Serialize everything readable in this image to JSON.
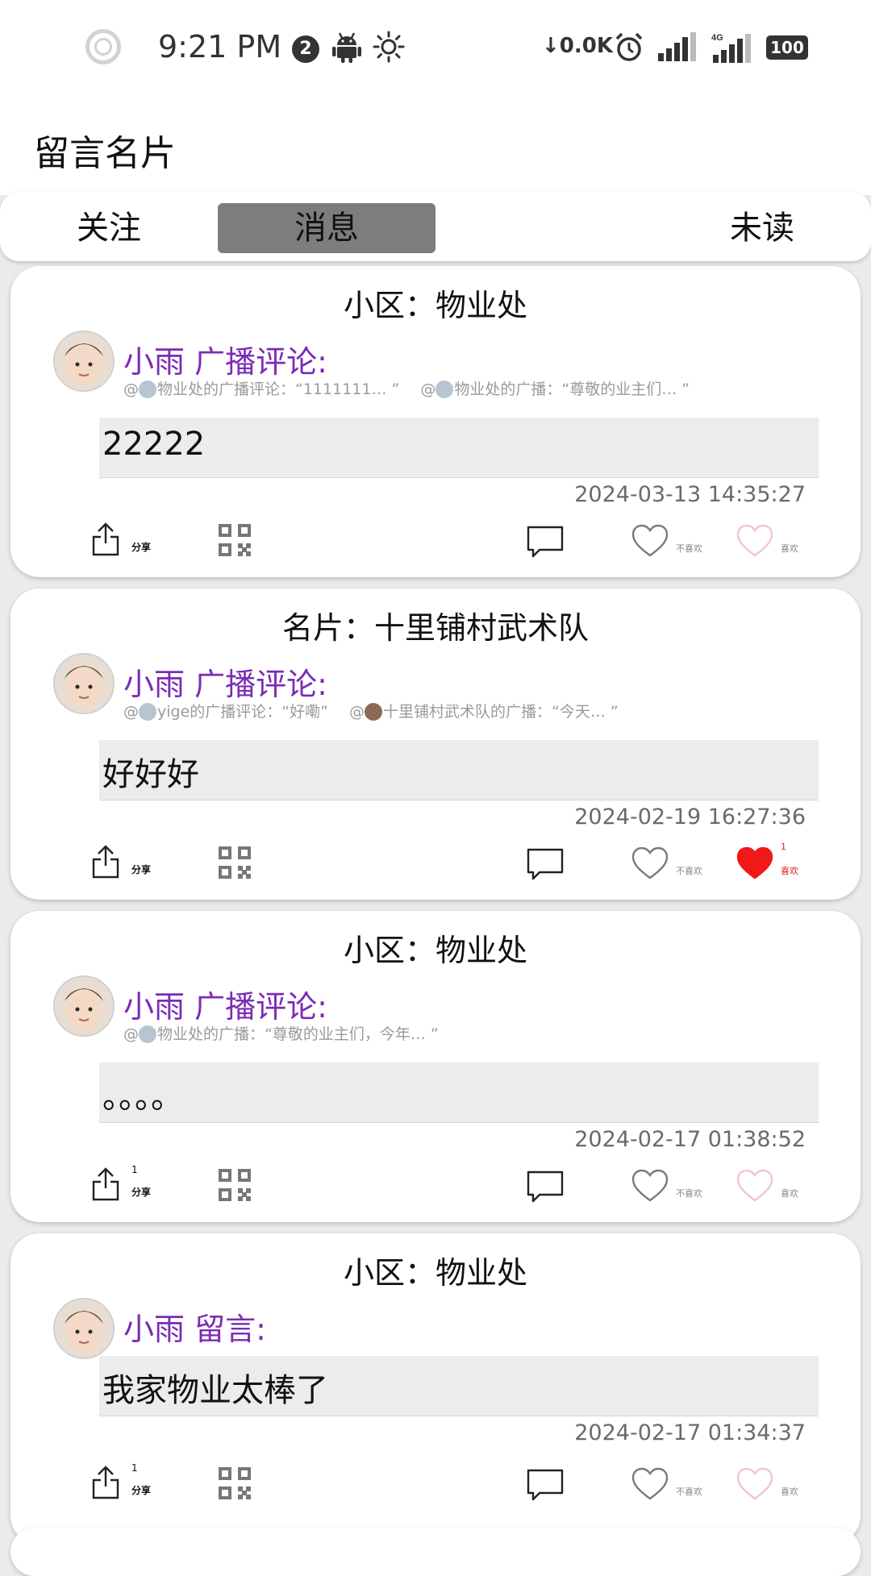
{
  "status_bar": {
    "time": "9:21 PM",
    "notification_count": "2",
    "net_speed": "0.0K",
    "network_label": "4G",
    "battery": "100"
  },
  "header": {
    "title": "留言名片"
  },
  "tabs": [
    {
      "label": "关注",
      "selected": false
    },
    {
      "label": "消息",
      "selected": true
    },
    {
      "label": "未读",
      "selected": false
    }
  ],
  "cards": [
    {
      "title": "小区：物业处",
      "author": "小雨 广播评论:",
      "quotes": [
        "物业处的广播评论：“1111111… ”",
        "物业处的广播：“尊敬的业主们… ”"
      ],
      "content": "22222",
      "time": "2024-03-13 14:35:27",
      "share_label": "分享",
      "share_count": "",
      "dislike_label": "不喜欢",
      "like_label": "喜欢",
      "like_count": "",
      "liked": false
    },
    {
      "title": "名片：十里铺村武术队",
      "author": "小雨 广播评论:",
      "quotes": [
        "yige的广播评论：“好嘞”",
        "十里铺村武术队的广播：“今天… ”"
      ],
      "content": "好好好",
      "time": "2024-02-19 16:27:36",
      "share_label": "分享",
      "share_count": "",
      "dislike_label": "不喜欢",
      "like_label": "喜欢",
      "like_count": "1",
      "liked": true
    },
    {
      "title": "小区：物业处",
      "author": "小雨 广播评论:",
      "quotes": [
        "物业处的广播：“尊敬的业主们，今年… ”"
      ],
      "content": "。。。。",
      "time": "2024-02-17 01:38:52",
      "share_label": "分享",
      "share_count": "1",
      "dislike_label": "不喜欢",
      "like_label": "喜欢",
      "like_count": "",
      "liked": false
    },
    {
      "title": "小区：物业处",
      "author": "小雨 留言:",
      "quotes": [],
      "content": "我家物业太棒了",
      "time": "2024-02-17 01:34:37",
      "share_label": "分享",
      "share_count": "1",
      "dislike_label": "不喜欢",
      "like_label": "喜欢",
      "like_count": "",
      "liked": false
    }
  ],
  "colors": {
    "author": "#7b2bb5",
    "like_active": "#e02020",
    "like_inactive": "#f4c3d2",
    "tab_selected_bg": "#7d7d7d"
  }
}
